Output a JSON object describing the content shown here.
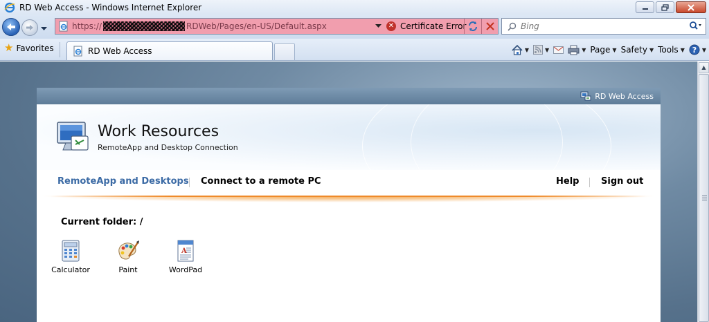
{
  "window": {
    "title": "RD Web Access - Windows Internet Explorer"
  },
  "address_bar": {
    "url_prefix": "https://",
    "url_suffix": "RDWeb/Pages/en-US/Default.aspx",
    "certificate_status": "Certificate Error",
    "background_color": "#f19eae"
  },
  "search": {
    "placeholder": "Bing"
  },
  "favorites_bar": {
    "favorites_label": "Favorites",
    "tab_title": "RD Web Access"
  },
  "command_bar": {
    "page_label": "Page",
    "safety_label": "Safety",
    "tools_label": "Tools"
  },
  "rd_page": {
    "top_label": "RD Web Access",
    "title": "Work Resources",
    "subtitle": "RemoteApp and Desktop Connection",
    "nav": {
      "remoteapp_tab": "RemoteApp and Desktops",
      "connect_tab": "Connect to a remote PC",
      "help": "Help",
      "sign_out": "Sign out"
    },
    "current_folder": "Current folder: /",
    "apps": [
      {
        "label": "Calculator",
        "icon": "calculator-icon"
      },
      {
        "label": "Paint",
        "icon": "paint-palette-icon"
      },
      {
        "label": "WordPad",
        "icon": "wordpad-icon"
      }
    ],
    "accent_color": "#3c6ba5",
    "nav_underline_color": "#ef8a2a"
  }
}
